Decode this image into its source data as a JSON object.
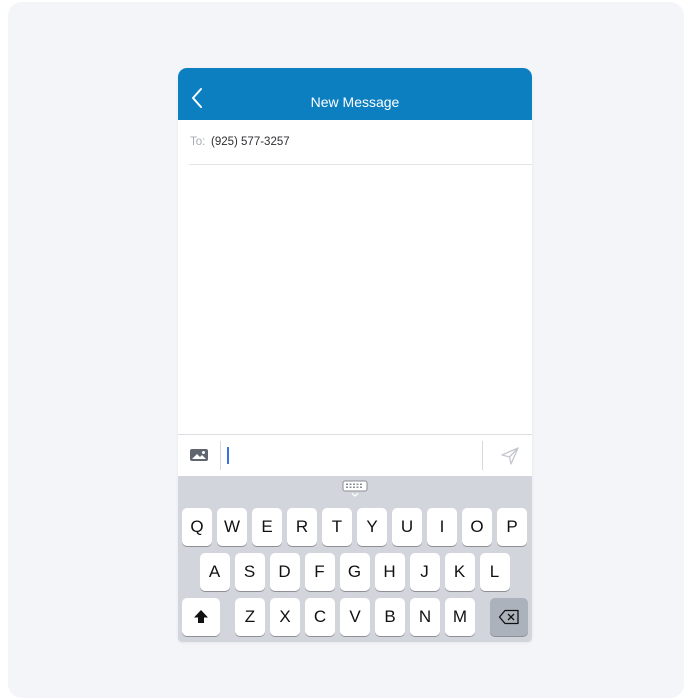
{
  "header": {
    "title": "New Message",
    "back_icon": "chevron-left-icon"
  },
  "recipient": {
    "label": "To:",
    "value": "(925) 577-3257"
  },
  "composer": {
    "image_icon": "image-icon",
    "send_icon": "send-icon",
    "value": ""
  },
  "keyboard": {
    "dismiss_icon": "keyboard-dismiss-icon",
    "row1": [
      "Q",
      "W",
      "E",
      "R",
      "T",
      "Y",
      "U",
      "I",
      "O",
      "P"
    ],
    "row2": [
      "A",
      "S",
      "D",
      "F",
      "G",
      "H",
      "J",
      "K",
      "L"
    ],
    "row3": [
      "Z",
      "X",
      "C",
      "V",
      "B",
      "N",
      "M"
    ],
    "shift_icon": "shift-icon",
    "delete_icon": "backspace-icon"
  },
  "colors": {
    "header_bg": "#0c7fc0",
    "keyboard_bg": "#d2d5db",
    "caret": "#3f6fe0"
  }
}
